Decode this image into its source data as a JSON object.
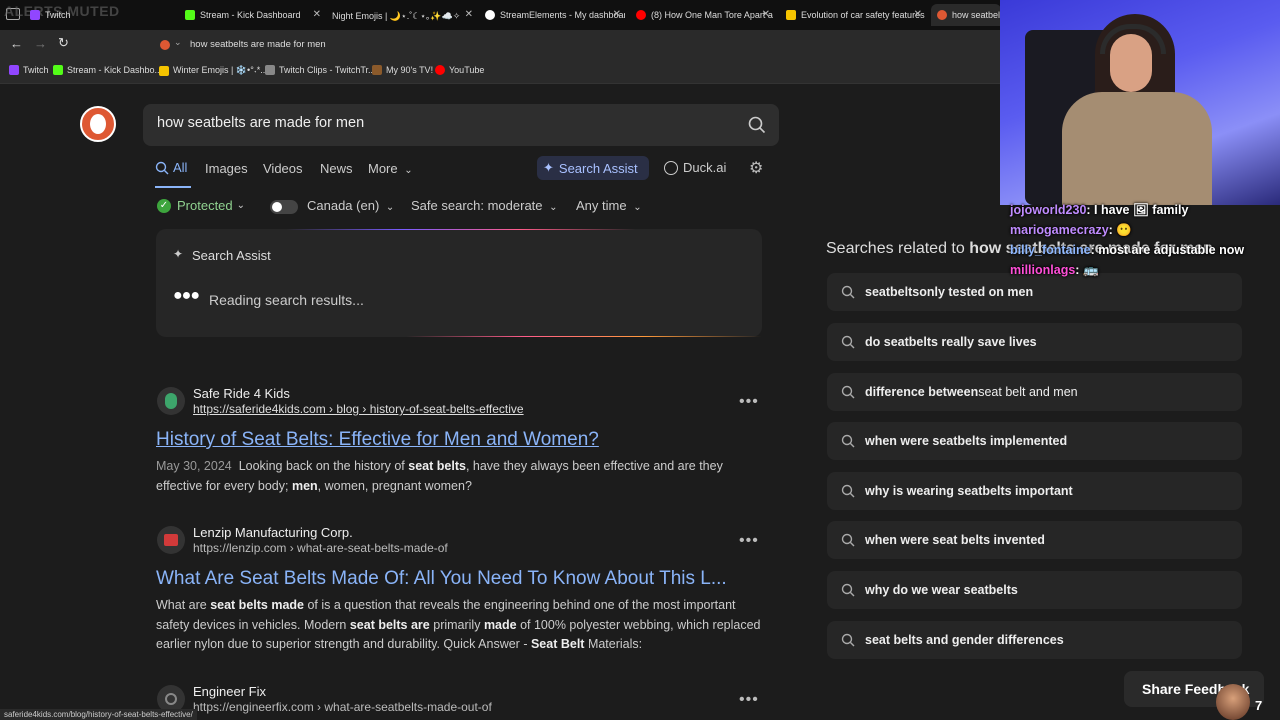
{
  "overlay": {
    "muted_text": "ALERTS MUTED"
  },
  "tabs": [
    {
      "label": "Twitch",
      "color": "#9146ff"
    },
    {
      "label": "Stream - Kick Dashboard",
      "color": "#53fc18"
    },
    {
      "label": "Night Emojis | 🌙⋆.˚☾⋆｡✨☁️✧",
      "color": "#888888"
    },
    {
      "label": "StreamElements - My dashboar",
      "color": "#ffffff"
    },
    {
      "label": "(8) How One Man Tore Apart a",
      "color": "#ff0000"
    },
    {
      "label": "Evolution of car safety features",
      "color": "#f5c400"
    },
    {
      "label": "how seatbelts",
      "color": "#de5833"
    }
  ],
  "navbar": {
    "url": "how seatbelts are made for men"
  },
  "bookmarks": [
    {
      "label": "Twitch",
      "color": "#9146ff"
    },
    {
      "label": "Stream - Kick Dashbo...",
      "color": "#53fc18"
    },
    {
      "label": "Winter Emojis | ❄️•°˖*...",
      "color": "#f5c400"
    },
    {
      "label": "Twitch Clips - TwitchTr...",
      "color": "#888888"
    },
    {
      "label": "My 90's TV!",
      "color": "#8b5a2b"
    },
    {
      "label": "YouTube",
      "color": "#ff0000"
    }
  ],
  "search": {
    "query": "how seatbelts are made for men"
  },
  "nav_tabs": {
    "all": "All",
    "images": "Images",
    "videos": "Videos",
    "news": "News",
    "more": "More",
    "search_assist": "Search Assist",
    "duck_ai": "Duck.ai"
  },
  "filters": {
    "protected": "Protected",
    "region": "Canada (en)",
    "safe_search": "Safe search: moderate",
    "time": "Any time"
  },
  "assist": {
    "title": "Search Assist",
    "status": "Reading search results..."
  },
  "results": [
    {
      "source": "Safe Ride 4 Kids",
      "url": "https://saferide4kids.com › blog › history-of-seat-belts-effective",
      "title": "History of Seat Belts: Effective for Men and Women?",
      "date": "May 30, 2024",
      "snippet_pre": "Looking back on the history of ",
      "snippet_b1": "seat belts",
      "snippet_mid": ", have they always been effective and are they effective for every body; ",
      "snippet_b2": "men",
      "snippet_post": ", women, pregnant women?"
    },
    {
      "source": "Lenzip Manufacturing Corp.",
      "url": "https://lenzip.com › what-are-seat-belts-made-of",
      "title": "What Are Seat Belts Made Of: All You Need To Know About This L...",
      "s1": "What are ",
      "s2": "seat belts made",
      "s3": " of is a question that reveals the engineering behind one of the most important safety devices in vehicles. Modern ",
      "s4": "seat belts are",
      "s5": " primarily ",
      "s6": "made",
      "s7": " of 100% polyester webbing, which replaced earlier nylon due to superior strength and durability. Quick Answer - ",
      "s8": "Seat Belt",
      "s9": " Materials:"
    },
    {
      "source": "Engineer Fix",
      "url": "https://engineerfix.com › what-are-seatbelts-made-out-of"
    }
  ],
  "related": {
    "heading_pre": "Searches related to ",
    "heading_query": "how seatbelts are made for men",
    "items": [
      {
        "pre": "seatbelts ",
        "bold": "only tested on men"
      },
      {
        "pre": "",
        "bold": "do seatbelts really save lives"
      },
      {
        "pre": "",
        "bold": "difference between ",
        "tail": "seat belt and men"
      },
      {
        "pre": "",
        "bold": "when were seatbelts implemented"
      },
      {
        "pre": "",
        "bold": "why is wearing seatbelts important"
      },
      {
        "pre": "",
        "bold": "when were seat belts invented"
      },
      {
        "pre": "",
        "bold": "why do we wear seatbelts"
      },
      {
        "pre": "",
        "bold": "seat belts and gender differences"
      }
    ]
  },
  "chat": [
    {
      "user": "jojoworld230",
      "user_color": "#c08cff",
      "message": "I have 🖼 family"
    },
    {
      "user": "mariogamecrazy",
      "user_color": "#c08cff",
      "message": "😶"
    },
    {
      "user": "billy_fontaine",
      "user_color": "#8fb8ff",
      "message": "most are adjustable now"
    },
    {
      "user": "millionlags",
      "user_color": "#ff4fd8",
      "message": "🚌"
    }
  ],
  "status_url": "saferide4kids.com/blog/history-of-seat-belts-effective/",
  "feedback": {
    "label": "Share Feedback",
    "count": "7"
  }
}
